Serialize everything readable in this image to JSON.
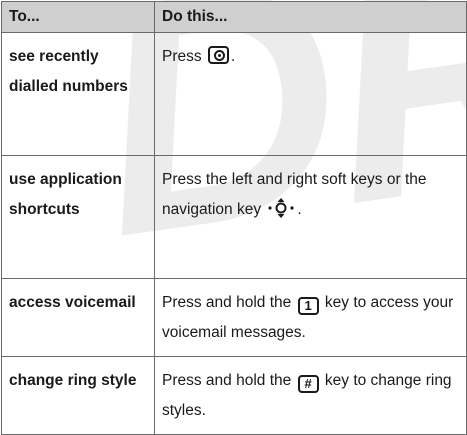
{
  "watermark": "DRAFT",
  "table": {
    "header": {
      "col1": "To...",
      "col2": "Do this..."
    },
    "rows": [
      {
        "action": "see recently dialled numbers",
        "instruction_before": "Press",
        "icon": "send-key-icon",
        "instruction_after": "."
      },
      {
        "action": "use application shortcuts",
        "instruction_before": "Press the left and right soft keys or the navigation key",
        "icon": "navigation-key-icon",
        "instruction_after": "."
      },
      {
        "action": "access voicemail",
        "instruction_before": "Press and hold the",
        "icon": "one-key-icon",
        "icon_label": "1",
        "instruction_after": "key to access your voicemail messages."
      },
      {
        "action": "change ring style",
        "instruction_before": "Press and hold the",
        "icon": "hash-key-icon",
        "icon_label": "#",
        "instruction_after": "key to change ring styles."
      }
    ]
  }
}
